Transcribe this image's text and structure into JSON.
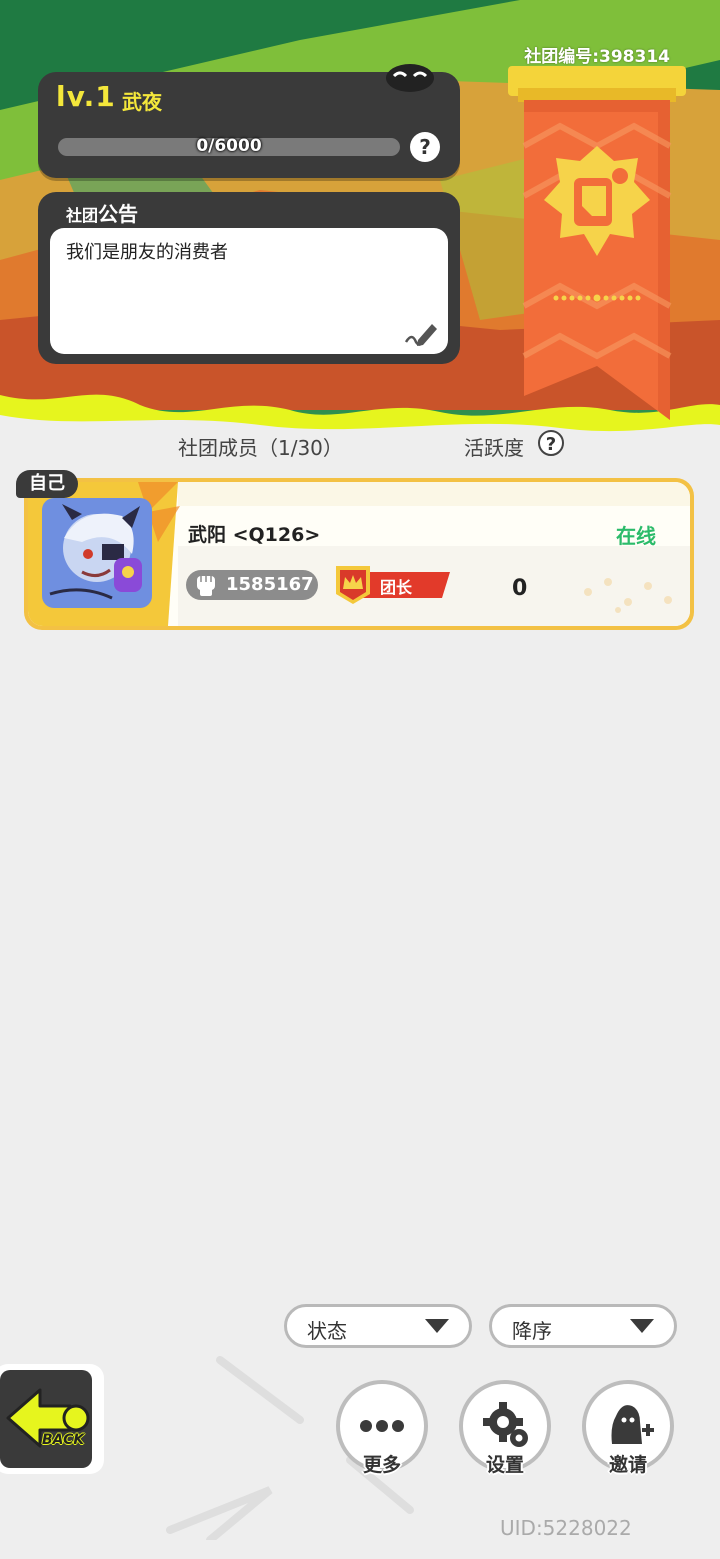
{
  "club": {
    "id_label": "社团编号:398314",
    "level": "lv.1",
    "name": "武夜",
    "exp_text": "0/6000",
    "exp_fraction": 0,
    "notice_title_prefix": "社团",
    "notice_title_main": "公告",
    "notice_text": "我们是朋友的消费者"
  },
  "members_header": {
    "count_label": "社团成员（1/30）",
    "activity_label": "活跃度"
  },
  "members": [
    {
      "self_tag": "自己",
      "name": "武阳 <Q126>",
      "status": "在线",
      "power": "1585167",
      "role": "团长",
      "activity": "0"
    }
  ],
  "filters": {
    "status_label": "状态",
    "order_label": "降序"
  },
  "actions": {
    "more_label": "更多",
    "settings_label": "设置",
    "invite_label": "邀请",
    "back_label": "BACK"
  },
  "footer": {
    "uid": "UID:5228022"
  },
  "colors": {
    "accent_yellow": "#f4e73b",
    "online_green": "#2bbb6a",
    "banner_orange": "#f26d3a",
    "card_gold": "#f3c144"
  }
}
